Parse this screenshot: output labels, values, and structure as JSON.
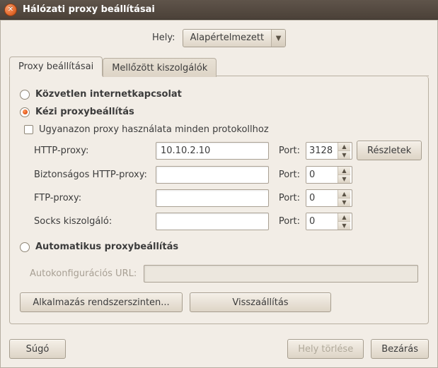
{
  "window": {
    "title": "Hálózati proxy beállításai"
  },
  "location": {
    "label": "Hely:",
    "selected": "Alapértelmezett"
  },
  "tabs": {
    "proxy": "Proxy beállításai",
    "ignored": "Mellőzött kiszolgálók"
  },
  "modes": {
    "direct": "Közvetlen internetkapcsolat",
    "manual": "Kézi proxybeállítás",
    "auto": "Automatikus proxybeállítás"
  },
  "manual": {
    "use_same": "Ugyanazon proxy használata minden protokollhoz",
    "port_label": "Port:",
    "details": "Részletek",
    "rows": {
      "http": {
        "label": "HTTP-proxy:",
        "host": "10.10.2.10",
        "port": "3128"
      },
      "https": {
        "label": "Biztonságos HTTP-proxy:",
        "host": "",
        "port": "0"
      },
      "ftp": {
        "label": "FTP-proxy:",
        "host": "",
        "port": "0"
      },
      "socks": {
        "label": "Socks kiszolgáló:",
        "host": "",
        "port": "0"
      }
    }
  },
  "auto": {
    "url_label": "Autokonfigurációs URL:",
    "url": ""
  },
  "apply": {
    "system": "Alkalmazás rendszerszinten...",
    "reset": "Visszaállítás"
  },
  "footer": {
    "help": "Súgó",
    "delete_location": "Hely törlése",
    "close": "Bezárás"
  }
}
